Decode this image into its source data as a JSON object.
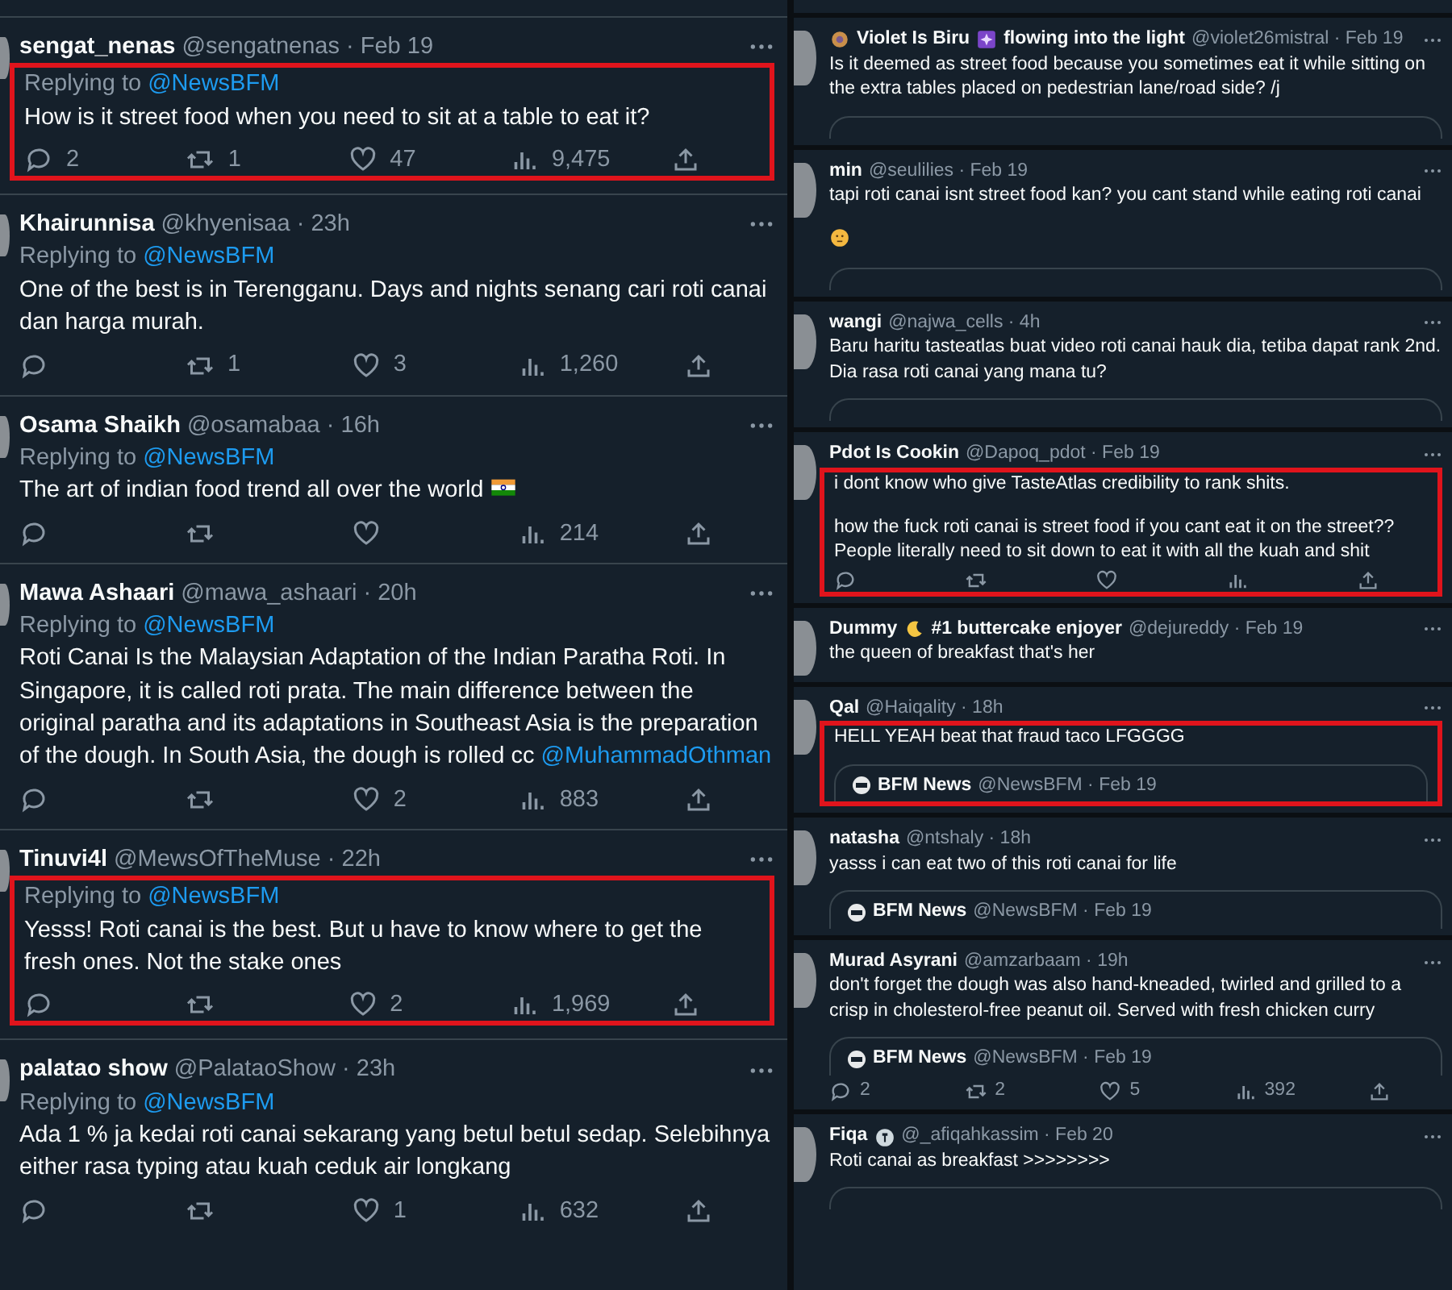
{
  "left_column": {
    "tweets": [
      {
        "name": "sengat_nenas",
        "meta": "@sengatnenas · Feb 19",
        "highlighted": true,
        "reply_label": "Replying to",
        "reply_to": "@NewsBFM",
        "text": [
          "How is it street food when you need to sit at a table to eat it?"
        ],
        "actions": {
          "replies": "2",
          "retweets": "1",
          "likes": "47",
          "views": "9,475"
        }
      },
      {
        "name": "Khairunnisa",
        "meta": "@khyenisaa · 23h",
        "highlighted": false,
        "reply_label": "Replying to",
        "reply_to": "@NewsBFM",
        "text": [
          "One of the best is in Terengganu. Days and nights senang cari roti canai dan harga murah."
        ],
        "actions": {
          "retweets": "1",
          "likes": "3",
          "views": "1,260"
        }
      },
      {
        "name": "Osama Shaikh",
        "meta": "@osamabaa · 16h",
        "highlighted": false,
        "reply_label": "Replying to",
        "reply_to": "@NewsBFM",
        "text": [
          "The art of indian food trend all over the world"
        ],
        "body_emoji": {
          "kind": "flag"
        },
        "actions": {
          "views": "214"
        }
      },
      {
        "name": "Mawa Ashaari",
        "meta": "@mawa_ashaari · 20h",
        "highlighted": false,
        "reply_label": "Replying to",
        "reply_to": "@NewsBFM",
        "text": [
          "Roti Canai Is the Malaysian Adaptation of the Indian Paratha Roti. In Singapore, it is called roti prata. The main difference between the original paratha and its adaptations in Southeast Asia is the preparation of the dough. In South Asia, the dough is rolled cc"
        ],
        "mention": "@MuhammadOthman",
        "actions": {
          "likes": "2",
          "views": "883"
        }
      },
      {
        "name": "Tinuvi4l",
        "meta": "@MewsOfTheMuse · 22h",
        "highlighted": true,
        "reply_label": "Replying to",
        "reply_to": "@NewsBFM",
        "text": [
          "Yesss! Roti canai is the best. But u have to know where to get the fresh ones. Not the stake ones"
        ],
        "actions": {
          "likes": "2",
          "views": "1,969"
        }
      },
      {
        "name": "palatao show",
        "meta": "@PalataoShow · 23h",
        "highlighted": false,
        "reply_label": "Replying to",
        "reply_to": "@NewsBFM",
        "text": [
          "Ada 1 % ja kedai roti canai sekarang yang betul betul sedap. Selebihnya either rasa typing atau kuah ceduk air longkang"
        ],
        "actions": {
          "likes": "1",
          "views": "632"
        }
      }
    ]
  },
  "right_column": {
    "tweets": [
      {
        "name_parts": [
          {
            "kind": "flower-emoji"
          },
          {
            "kind": "text",
            "text": "Violet Is Biru"
          },
          {
            "kind": "sparkle-emoji"
          },
          {
            "kind": "text",
            "text": "flowing into the light"
          }
        ],
        "meta": "@violet26mistral · Feb 19",
        "highlighted": false,
        "text": [
          "Is it deemed as street food because you sometimes eat it while sitting on the extra tables placed on pedestrian lane/road side? /j"
        ],
        "quote_cut": true
      },
      {
        "name": "min",
        "meta": "@seulilies · Feb 19",
        "highlighted": false,
        "text": [
          "tapi roti canai isnt street food kan? you cant stand while eating roti canai"
        ],
        "body_emoji": {
          "kind": "thinking"
        },
        "quote_cut": true
      },
      {
        "name": "wangi",
        "meta": "@najwa_cells · 4h",
        "highlighted": false,
        "text": [
          "Baru haritu tasteatlas buat video roti canai hauk dia, tetiba dapat rank 2nd. Dia rasa roti canai yang mana tu?"
        ],
        "quote_cut": true
      },
      {
        "name": "Pdot Is Cookin",
        "meta": "@Dapoq_pdot · Feb 19",
        "highlighted": true,
        "text": [
          "i dont know who give TasteAtlas credibility to rank shits.",
          "how the fuck roti canai is street food if you cant eat it on the street?? People literally need to sit down to eat it with all the kuah and shit"
        ],
        "action_bar": true
      },
      {
        "name_parts": [
          {
            "kind": "text",
            "text": "Dummy"
          },
          {
            "kind": "moon-emoji"
          },
          {
            "kind": "text",
            "text": "#1 buttercake enjoyer"
          }
        ],
        "meta": "@dejureddy · Feb 19",
        "highlighted": false,
        "text": [
          "the queen of breakfast that's her"
        ]
      },
      {
        "name": "Qal",
        "meta": "@Haiqality · 18h",
        "highlighted": true,
        "text": [
          "HELL YEAH beat that fraud taco LFGGGG"
        ],
        "quote": {
          "name": "BFM News",
          "meta": "@NewsBFM · Feb 19"
        }
      },
      {
        "name": "natasha",
        "meta": "@ntshaly · 18h",
        "highlighted": false,
        "text": [
          "yasss i can eat two of this roti canai for life"
        ],
        "quote": {
          "name": "BFM News",
          "meta": "@NewsBFM · Feb 19"
        }
      },
      {
        "name": "Murad Asyrani",
        "meta": "@amzarbaam · 19h",
        "highlighted": false,
        "text": [
          "don't forget the dough was also hand-kneaded, twirled and grilled to a crisp in cholesterol-free peanut oil.  Served with fresh chicken curry"
        ],
        "quote": {
          "name": "BFM News",
          "meta": "@NewsBFM · Feb 19"
        },
        "actions": {
          "replies": "2",
          "retweets": "2",
          "likes": "5",
          "views": "392"
        }
      },
      {
        "name_parts": [
          {
            "kind": "text",
            "text": "Fiqa"
          },
          {
            "kind": "badge-emoji"
          }
        ],
        "meta": "@_afiqahkassim · Feb 20",
        "highlighted": false,
        "text": [
          "Roti canai as breakfast >>>>>>>>"
        ],
        "quote_cut": true
      }
    ]
  }
}
